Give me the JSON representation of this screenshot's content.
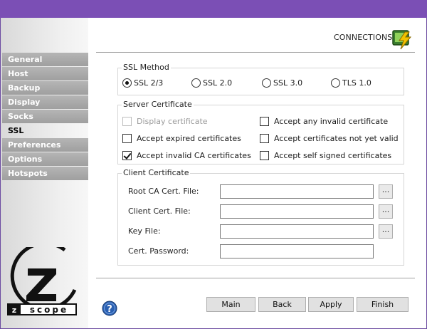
{
  "header": {
    "title": "CONNECTIONS"
  },
  "sidebar": {
    "items": [
      {
        "label": "General",
        "active": false
      },
      {
        "label": "Host",
        "active": false
      },
      {
        "label": "Backup",
        "active": false
      },
      {
        "label": "Display",
        "active": false
      },
      {
        "label": "Socks",
        "active": false
      },
      {
        "label": "SSL",
        "active": true
      },
      {
        "label": "Preferences",
        "active": false
      },
      {
        "label": "Options",
        "active": false
      },
      {
        "label": "Hotspots",
        "active": false
      }
    ],
    "logo_text": "zscope"
  },
  "ssl_method": {
    "title": "SSL Method",
    "options": [
      {
        "label": "SSL 2/3",
        "checked": true
      },
      {
        "label": "SSL 2.0",
        "checked": false
      },
      {
        "label": "SSL 3.0",
        "checked": false
      },
      {
        "label": "TLS 1.0",
        "checked": false
      }
    ]
  },
  "server_certificate": {
    "title": "Server Certificate",
    "options": [
      {
        "label": "Display certificate",
        "checked": false,
        "disabled": true
      },
      {
        "label": "Accept any invalid certificate",
        "checked": false,
        "disabled": false
      },
      {
        "label": "Accept expired certificates",
        "checked": false,
        "disabled": false
      },
      {
        "label": "Accept certificates not yet valid",
        "checked": false,
        "disabled": false
      },
      {
        "label": "Accept invalid CA certificates",
        "checked": true,
        "disabled": false
      },
      {
        "label": "Accept self signed certificates",
        "checked": false,
        "disabled": false
      }
    ]
  },
  "client_certificate": {
    "title": "Client Certificate",
    "fields": [
      {
        "label": "Root CA Cert. File:",
        "value": "",
        "browse": "..."
      },
      {
        "label": "Client Cert. File:",
        "value": "",
        "browse": "..."
      },
      {
        "label": "Key File:",
        "value": "",
        "browse": "..."
      },
      {
        "label": "Cert. Password:",
        "value": ""
      }
    ]
  },
  "footer": {
    "buttons": {
      "main": "Main",
      "back": "Back",
      "apply": "Apply",
      "finish": "Finish"
    }
  },
  "colors": {
    "titlebar": "#7b4fb5",
    "nav_item": "#a8a8a8",
    "help_icon": "#2a5fb0"
  }
}
